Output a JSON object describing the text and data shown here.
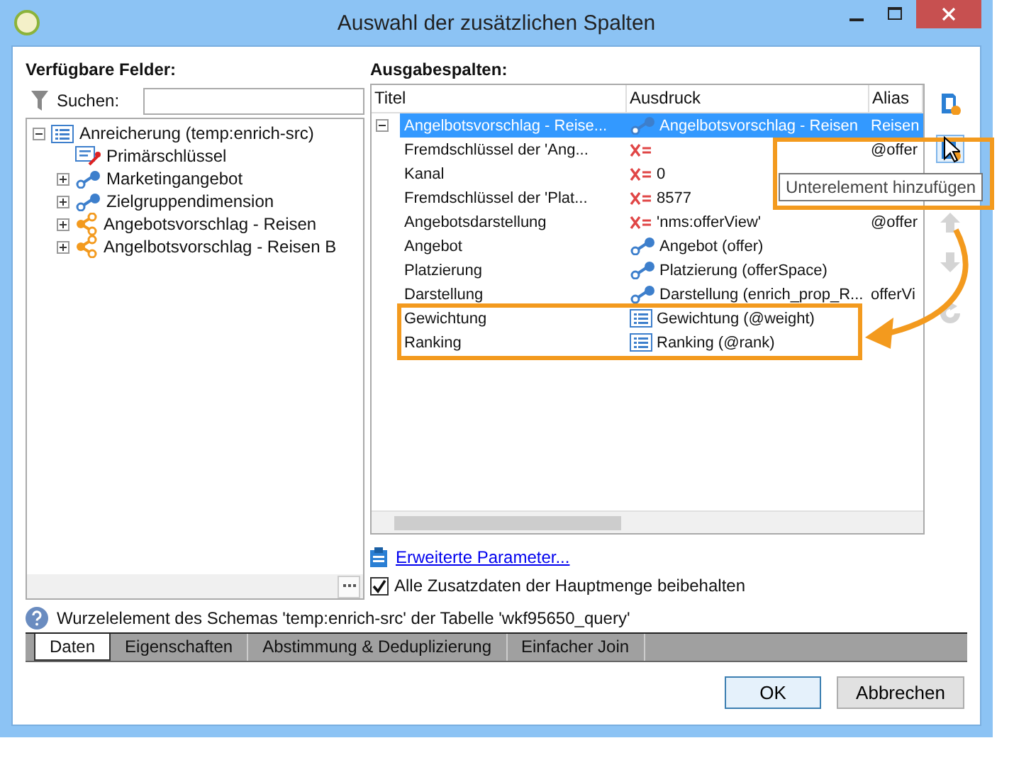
{
  "window": {
    "title": "Auswahl der zusätzlichen Spalten"
  },
  "available_fields": {
    "label": "Verfügbare Felder:",
    "search_label": "Suchen:",
    "tree": [
      {
        "label": "Anreicherung (temp:enrich-src)",
        "kind": "list",
        "expanded": true,
        "children": [
          {
            "label": "Primärschlüssel",
            "kind": "key"
          },
          {
            "label": "Marketingangebot",
            "kind": "link",
            "expanded": false
          },
          {
            "label": "Zielgruppendimension",
            "kind": "link",
            "expanded": false
          },
          {
            "label": "Angebotsvorschlag - Reisen",
            "kind": "share",
            "expanded": false
          },
          {
            "label": "Angelbotsvorschlag - Reisen B",
            "kind": "share",
            "expanded": false
          }
        ]
      }
    ]
  },
  "output_columns": {
    "label": "Ausgabespalten:",
    "columns": [
      "Titel",
      "Ausdruck",
      "Alias"
    ],
    "rows": [
      {
        "title": "Angelbotsvorschlag - Reise...",
        "kind": "link",
        "expression": "Angelbotsvorschlag - Reisen",
        "alias": "Reisen",
        "selected": true,
        "expanded": true,
        "children": [
          {
            "title": "Fremdschlüssel der 'Ang...",
            "kind": "formula",
            "alias": "@offer",
            "selected": false
          },
          {
            "title": "Kanal",
            "kind": "formula",
            "expression": "0",
            "selected": false
          },
          {
            "title": "Fremdschlüssel der 'Plat...",
            "kind": "formula",
            "expression": "8577",
            "selected": false
          },
          {
            "title": "Angebotsdarstellung",
            "kind": "formula",
            "expression": "'nms:offerView'",
            "alias": "@offer",
            "selected": false
          },
          {
            "title": "Angebot",
            "kind": "link",
            "expression": "Angebot (offer)",
            "selected": false
          },
          {
            "title": "Platzierung",
            "kind": "link",
            "expression": "Platzierung (offerSpace)",
            "selected": false
          },
          {
            "title": "Darstellung",
            "kind": "link",
            "expression": "Darstellung (enrich_prop_R...",
            "alias": "offerVi",
            "selected": false
          },
          {
            "title": "Gewichtung",
            "kind": "list",
            "expression": "Gewichtung (@weight)",
            "selected": false
          },
          {
            "title": "Ranking",
            "kind": "list",
            "expression": "Ranking (@rank)",
            "selected": false
          }
        ]
      }
    ]
  },
  "toolbar": [
    {
      "kind": "add_column",
      "disabled": false,
      "hovered": false
    },
    {
      "kind": "add_child",
      "disabled": false,
      "hovered": true
    },
    {
      "kind": "move_up",
      "disabled": true,
      "hovered": false
    },
    {
      "kind": "move_down",
      "disabled": true,
      "hovered": false
    },
    {
      "kind": "rebuild",
      "disabled": true,
      "hovered": false
    }
  ],
  "tooltip": "Unterelement hinzufügen",
  "link": "Erweiterte Parameter...",
  "keep_checkbox": {
    "label": "Alle Zusatzdaten der Hauptmenge beibehalten",
    "checked": true
  },
  "help": "Wurzelelement des Schemas 'temp:enrich-src' der Tabelle 'wkf95650_query'",
  "tabs": [
    {
      "label": "Daten",
      "selected": true
    },
    {
      "label": "Eigenschaften",
      "selected": false
    },
    {
      "label": "Abstimmung & Deduplizierung",
      "selected": false
    },
    {
      "label": "Einfacher Join",
      "selected": false
    }
  ],
  "buttons": [
    {
      "label": "OK",
      "default": true
    },
    {
      "label": "Abbrechen",
      "default": false
    }
  ]
}
